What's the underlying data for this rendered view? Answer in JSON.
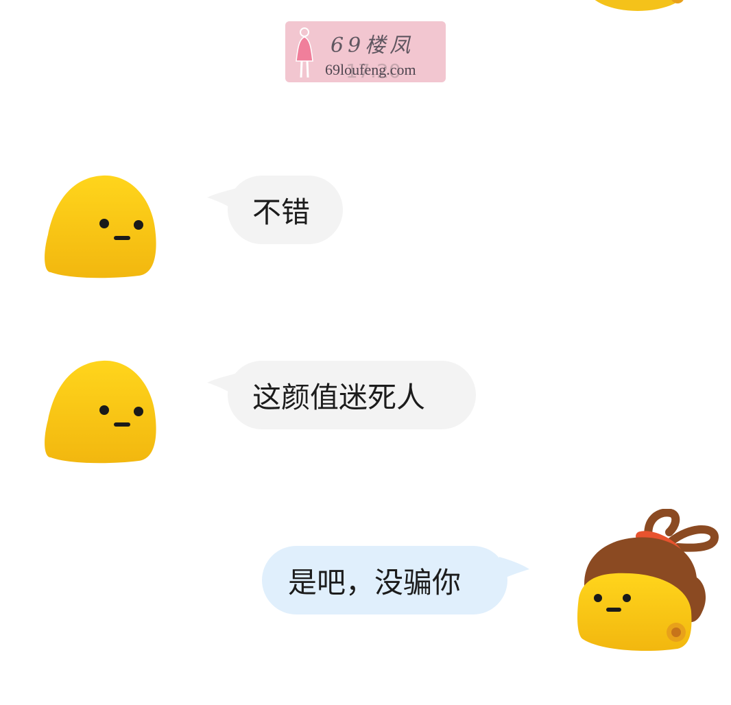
{
  "watermark": {
    "title": "69楼凤",
    "site": "69loufeng.com",
    "timestamp_behind": "17:20"
  },
  "messages": [
    {
      "side": "left",
      "text": "不错",
      "avatar": "yellow-blob-face"
    },
    {
      "side": "left",
      "text": "这颜值迷死人",
      "avatar": "yellow-blob-face"
    },
    {
      "side": "right",
      "text": "是吧，没骗你",
      "avatar": "yellow-blob-girl-with-hair-bun"
    }
  ],
  "colors": {
    "background": "#ffffff",
    "left_bubble": "#f3f3f3",
    "right_bubble": "#e0effc",
    "avatar_yellow": "#f7c71b",
    "hair_brown": "#8b4a22",
    "hair_tie_red": "#e8532e",
    "watermark_bg": "#f2c6d0"
  }
}
